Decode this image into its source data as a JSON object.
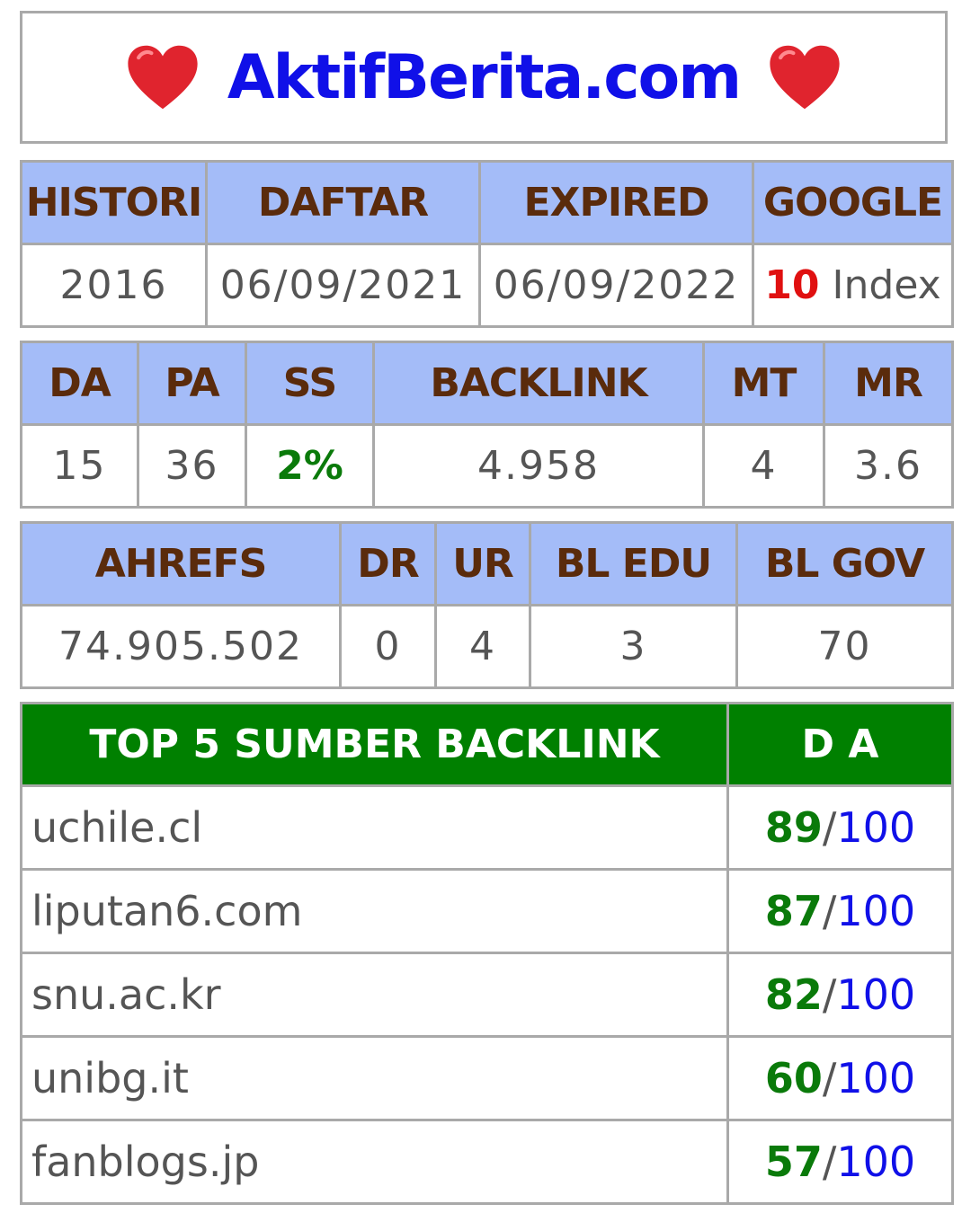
{
  "colors": {
    "header_bg": "#a4bcf8",
    "header_text": "#5a2b0c",
    "value_text": "#555555",
    "title_blue": "#1010e8",
    "red": "#e01010",
    "green": "#0a7a0a",
    "green_header_bg": "#008000",
    "slash_dark": "#555555",
    "border": "#a9a9a9",
    "heart": "#e0242e"
  },
  "title": {
    "text": "AktifBerita.com",
    "left_icon": "heart-icon",
    "right_icon": "heart-icon"
  },
  "table1": {
    "headers": [
      "HISTORI",
      "DAFTAR",
      "EXPIRED",
      "GOOGLE"
    ],
    "values": {
      "histori": "2016",
      "daftar": "06/09/2021",
      "expired": "06/09/2022",
      "google_count": "10",
      "google_label": "Index"
    }
  },
  "table2": {
    "headers": [
      "DA",
      "PA",
      "SS",
      "BACKLINK",
      "MT",
      "MR"
    ],
    "values": [
      "15",
      "36",
      "2%",
      "4.958",
      "4",
      "3.6"
    ]
  },
  "table3": {
    "headers": [
      "AHREFS",
      "DR",
      "UR",
      "BL EDU",
      "BL GOV"
    ],
    "values": [
      "74.905.502",
      "0",
      "4",
      "3",
      "70"
    ]
  },
  "top5": {
    "header_left": "TOP 5 SUMBER BACKLINK",
    "header_right": "D A",
    "rows": [
      {
        "domain": "uchile.cl",
        "score": "89",
        "sep": "/",
        "max": "100"
      },
      {
        "domain": "liputan6.com",
        "score": "87",
        "sep": "/",
        "max": "100"
      },
      {
        "domain": "snu.ac.kr",
        "score": "82",
        "sep": "/",
        "max": "100"
      },
      {
        "domain": "unibg.it",
        "score": "60",
        "sep": "/",
        "max": "100"
      },
      {
        "domain": "fanblogs.jp",
        "score": "57",
        "sep": "/",
        "max": "100"
      }
    ]
  }
}
